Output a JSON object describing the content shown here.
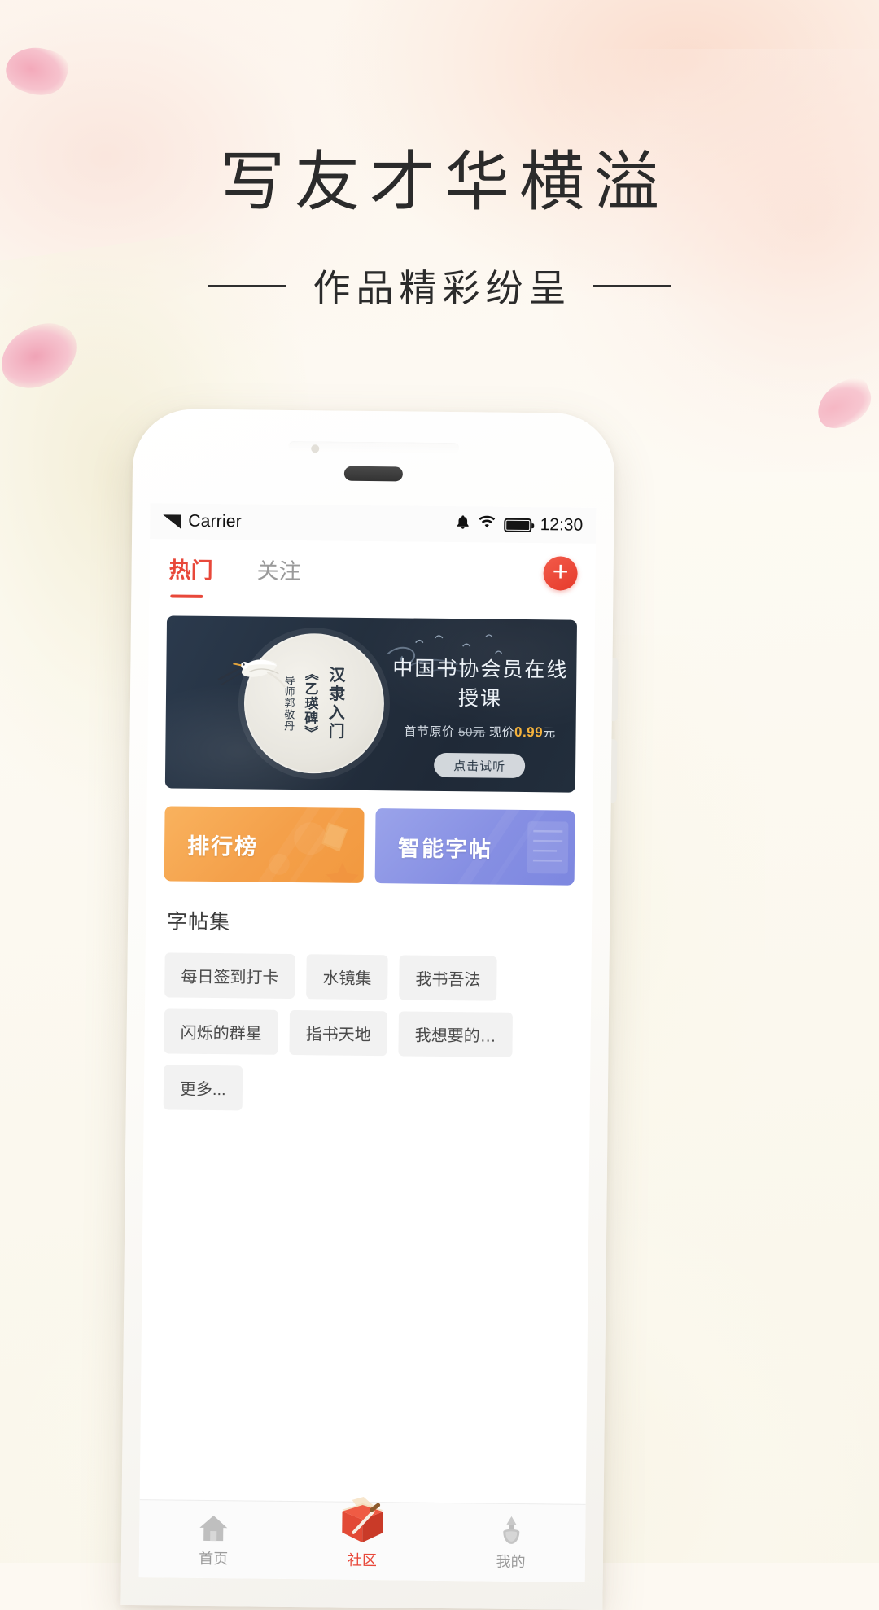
{
  "poster": {
    "title": "写友才华横溢",
    "subtitle": "作品精彩纷呈",
    "rule_left": "",
    "rule_right": ""
  },
  "status_bar": {
    "carrier": "Carrier",
    "time": "12:30",
    "signal_icon": "signal-bars-icon",
    "bell_icon": "bell-icon",
    "wifi_icon": "wifi-icon",
    "battery_icon": "battery-full-icon"
  },
  "top_tabs": {
    "items": [
      {
        "label": "热门",
        "active": true
      },
      {
        "label": "关注",
        "active": false
      }
    ],
    "add_button_glyph": "+"
  },
  "banner": {
    "seal_main": "汉隶入门",
    "seal_title": "《乙瑛碑》",
    "seal_teacher": "导师郭敬丹",
    "heading": "中国书协会员在线授课",
    "price_prefix": "首节原价",
    "price_old": "50元",
    "price_mid": "现价",
    "price_new": "0.99",
    "price_unit": "元",
    "cta": "点击试听"
  },
  "feature_cards": [
    {
      "label": "排行榜",
      "color": "#f4a04a"
    },
    {
      "label": "智能字帖",
      "color": "#868fe3"
    }
  ],
  "copybook": {
    "section_title": "字帖集",
    "chips": [
      "每日签到打卡",
      "水镜集",
      "我书吾法",
      "闪烁的群星",
      "指书天地",
      "我想要的…",
      "更多..."
    ]
  },
  "tab_bar": {
    "items": [
      {
        "label": "首页",
        "icon": "home-icon",
        "active": false
      },
      {
        "label": "社区",
        "icon": "community-book-icon",
        "active": true
      },
      {
        "label": "我的",
        "icon": "profile-brush-icon",
        "active": false
      }
    ]
  },
  "colors": {
    "accent": "#e8483a",
    "banner_bg": "#24303f",
    "card_orange": "#f4a04a",
    "card_purple": "#868fe3",
    "price_highlight": "#f4b23c"
  }
}
